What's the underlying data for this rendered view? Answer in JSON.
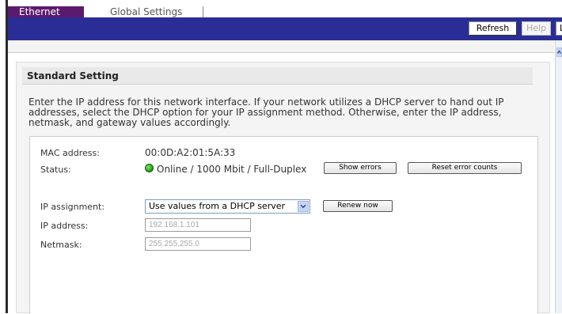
{
  "tabs": {
    "ethernet": "Ethernet",
    "global": "Global Settings"
  },
  "toolbar": {
    "refresh": "Refresh",
    "help": "Help",
    "cut_button": "L"
  },
  "panel": {
    "title": "Standard Setting",
    "description": "Enter the IP address for this network interface. If your network utilizes a DHCP server to hand out IP addresses, select the DHCP option for your IP assignment method. Otherwise, enter the IP address, netmask, and gateway values accordingly."
  },
  "iface": {
    "mac_label": "MAC address:",
    "mac_value": "00:0D:A2:01:5A:33",
    "status_label": "Status:",
    "status_value": "Online / 1000 Mbit / Full-Duplex",
    "status_color": "#22a316",
    "show_errors": "Show errors",
    "reset_errors": "Reset error counts",
    "ip_assign_label": "IP assignment:",
    "ip_assign_value": "Use values from a DHCP server",
    "renew": "Renew now",
    "ip_label": "IP address:",
    "ip_value": "192.168.1.101",
    "netmask_label": "Netmask:",
    "netmask_value": "255.255.255.0"
  },
  "colors": {
    "nav_bar": "#2a2d96",
    "active_tab": "#5c1a6e"
  },
  "icons": {
    "status_led": "green-status-led-icon",
    "dropdown": "chevron-down-icon",
    "scroll_up": "scroll-up-arrow-icon"
  }
}
